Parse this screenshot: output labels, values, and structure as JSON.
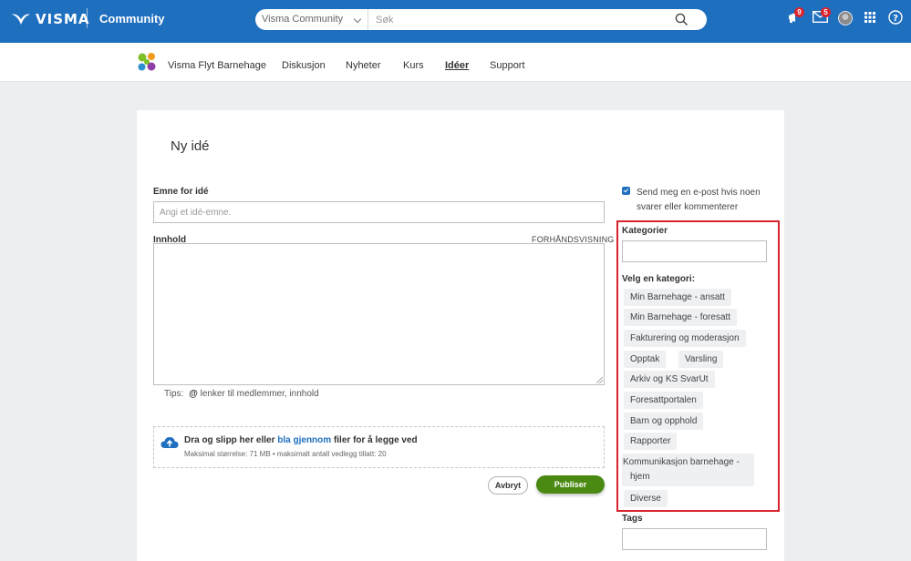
{
  "header": {
    "logo_text": "VISMA",
    "site_label": "Community",
    "search": {
      "scope": "Visma Community",
      "placeholder": "Søk"
    },
    "notifications_count": "9",
    "messages_count": "5",
    "brand_color": "#1f6fbf"
  },
  "subnav": {
    "logo_label": "Visma Flyt Barnehage",
    "items": [
      {
        "label": "Diskusjon",
        "active": false
      },
      {
        "label": "Nyheter",
        "active": false
      },
      {
        "label": "Kurs",
        "active": false
      },
      {
        "label": "Idéer",
        "active": true
      },
      {
        "label": "Support",
        "active": false
      }
    ]
  },
  "form": {
    "title": "Ny idé",
    "subject": {
      "label": "Emne for idé",
      "placeholder": "Angi et idé-emne.",
      "value": ""
    },
    "content": {
      "label": "Innhold",
      "preview_label": "FORHÅNDSVISNING",
      "value": ""
    },
    "tips": {
      "prefix": "Tips:",
      "at_symbol": "@",
      "text": "lenker til medlemmer, innhold"
    },
    "upload": {
      "text_before": "Dra og slipp her eller",
      "browse_link": "bla gjennom",
      "text_after": "filer for å legge ved",
      "limits": "Maksimal størrelse: 71 MB • maksimalt antall vedlegg tillatt: 20"
    },
    "cancel_label": "Avbryt",
    "publish_label": "Publiser"
  },
  "sidebar": {
    "notify": {
      "checked": true,
      "label": "Send meg en e-post hvis noen svarer eller kommenterer"
    },
    "categories_label": "Kategorier",
    "categories_value": "",
    "choose_category_label": "Velg en kategori:",
    "categories": [
      "Min Barnehage - ansatt",
      "Min Barnehage - foresatt",
      "Fakturering og moderasjon",
      "Opptak",
      "Varsling",
      "Arkiv og KS SvarUt",
      "Foresattportalen",
      "Barn og opphold",
      "Rapporter",
      "Kommunikasjon barnehage - hjem",
      "Diverse"
    ],
    "tags_label": "Tags",
    "tags_value": ""
  },
  "colors": {
    "publish": "#4a8a12",
    "highlight": "#d9232d",
    "badge": "#d9232d"
  }
}
